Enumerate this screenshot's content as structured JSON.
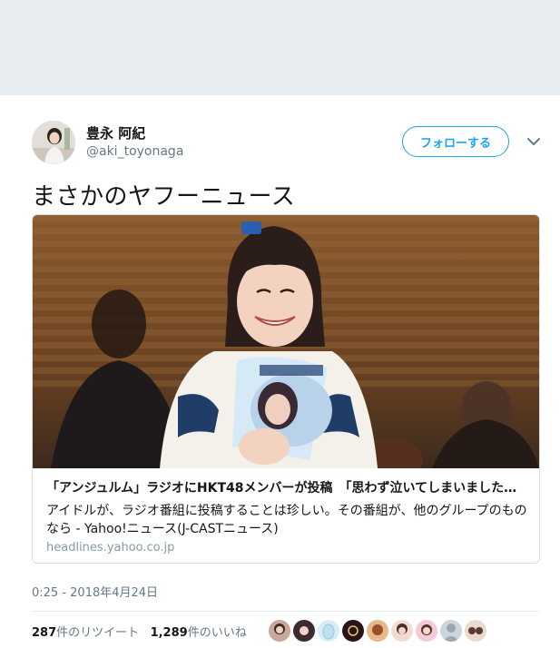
{
  "user": {
    "display_name": "豊永 阿紀",
    "handle": "@aki_toyonaga"
  },
  "actions": {
    "follow_label": "フォローする"
  },
  "tweet": {
    "text": "まさかのヤフーニュース",
    "timestamp": "0:25 - 2018年4月24日"
  },
  "card": {
    "title": "「アンジュルム」ラジオにHKT48メンバーが投稿　「思わず泣いてしまいました…",
    "description": "アイドルが、ラジオ番組に投稿することは珍しい。その番組が、他のグループのものなら - Yahoo!ニュース(J-CASTニュース)",
    "domain": "headlines.yahoo.co.jp"
  },
  "stats": {
    "retweets_count": "287",
    "retweets_label": "件のリツイート",
    "likes_count": "1,289",
    "likes_label": "件のいいね"
  },
  "colors": {
    "accent": "#1da1f2",
    "secondary_text": "#657786",
    "background_band": "#e6ecf0"
  },
  "icons": [
    "chevron-down-icon"
  ]
}
